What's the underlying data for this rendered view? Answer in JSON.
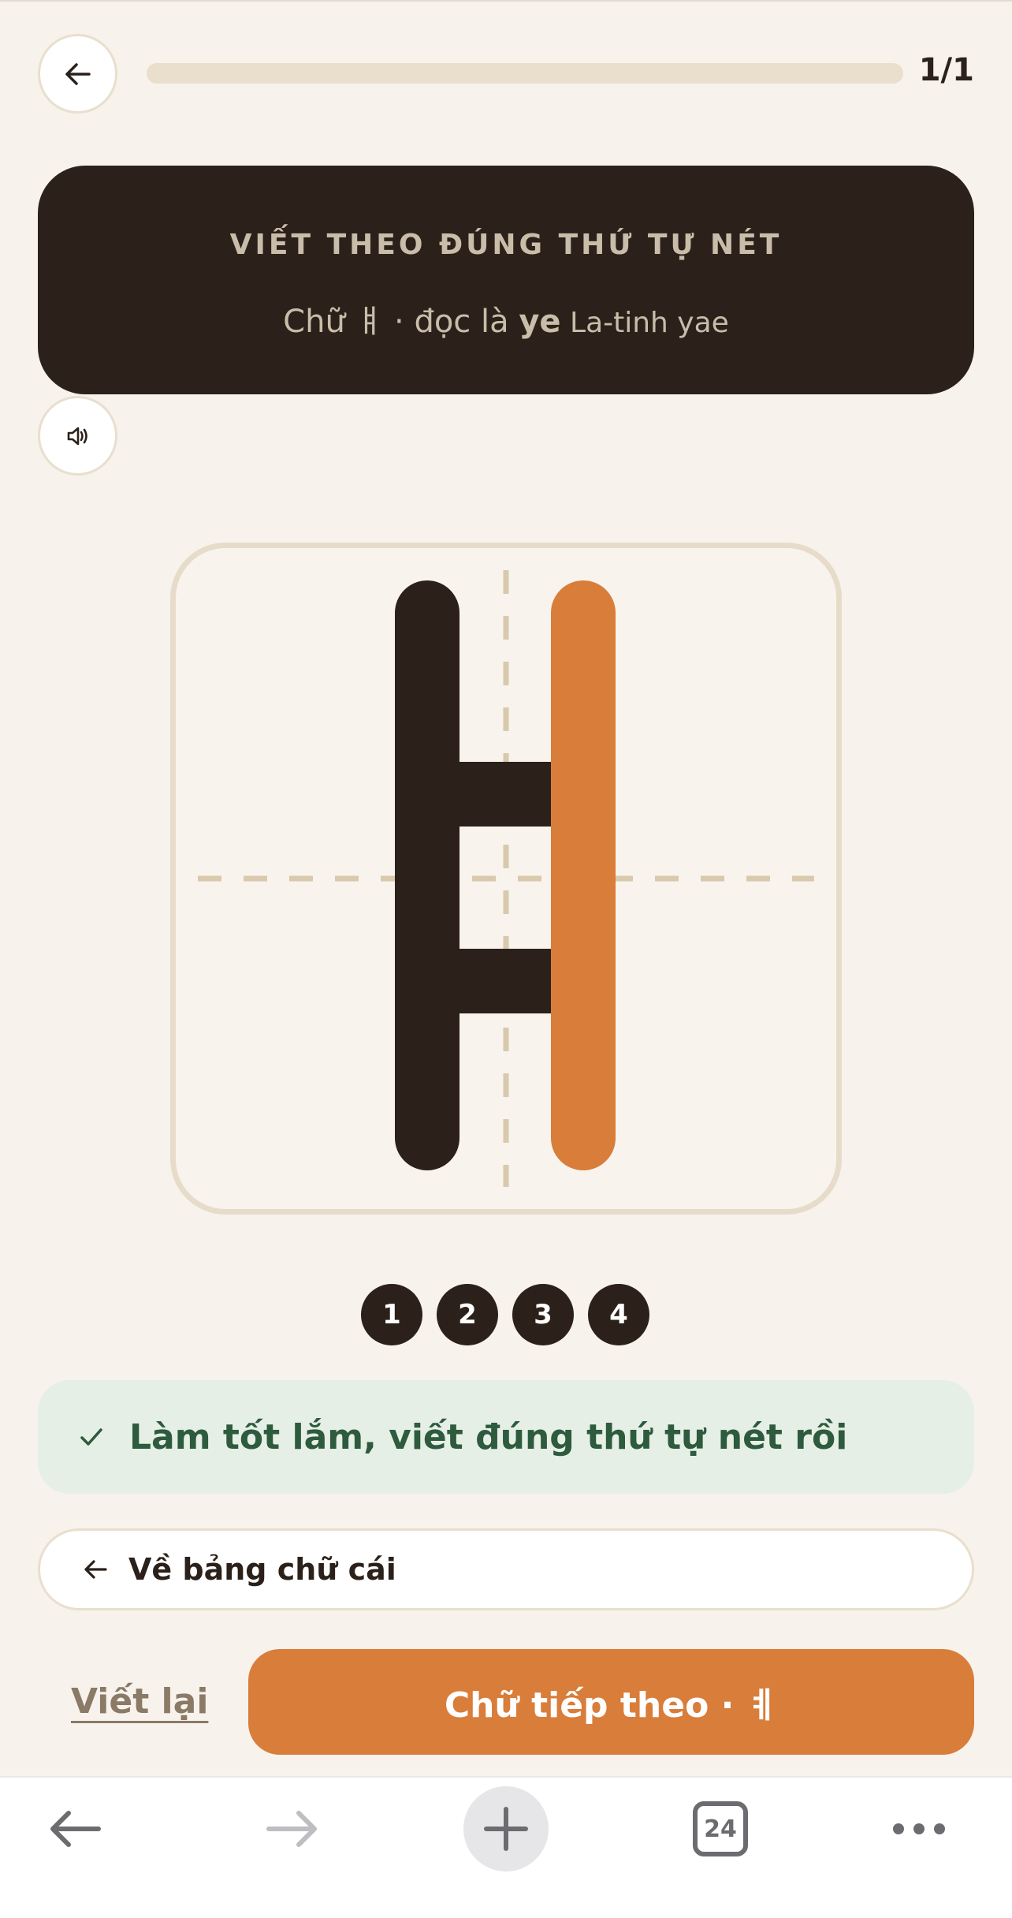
{
  "header": {
    "progress_label": "1/1",
    "progress_fraction": 1.0
  },
  "instruction": {
    "title": "VIẾT THEO ĐÚNG THỨ TỰ NÉT",
    "prefix": "Chữ ㅒ · đọc là ",
    "reading": "ye",
    "latin": " La-tinh yae"
  },
  "steps": [
    "1",
    "2",
    "3",
    "4"
  ],
  "feedback": {
    "message": "Làm tốt lắm, viết đúng thứ tự nét rồi"
  },
  "actions": {
    "back_to_alphabet": "Về bảng chữ cái",
    "rewrite": "Viết lại",
    "next": "Chữ tiếp theo · ㅖ"
  },
  "browser": {
    "tab_count": "24"
  },
  "colors": {
    "accent": "#d97d3a",
    "dark": "#2b211a",
    "success_text": "#2e5a3e",
    "success_bg": "#e5efe6"
  }
}
